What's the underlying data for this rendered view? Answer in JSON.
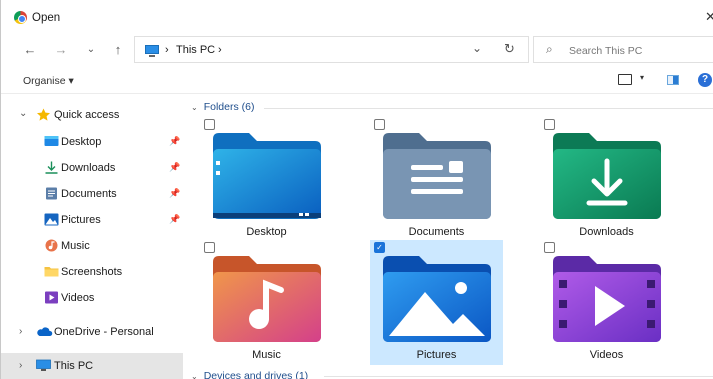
{
  "window": {
    "title": "Open",
    "close_glyph": "✕"
  },
  "nav": {
    "back": "←",
    "forward": "→",
    "recent": "⌄",
    "up": "↑"
  },
  "address": {
    "crumb_sep": "›",
    "location": "This PC",
    "trailing_sep": "›",
    "dropdown": "⌄",
    "refresh": "↻"
  },
  "search": {
    "placeholder": "Search This PC",
    "icon": "⌕"
  },
  "toolbar": {
    "organise": "Organise ▾",
    "view_caret": "▾",
    "help": "?"
  },
  "sidebar": {
    "items": [
      {
        "label": "Quick access",
        "chevron": "⌄",
        "icon": "star-icon"
      },
      {
        "label": "Desktop",
        "icon": "desktop-icon",
        "pinned": true
      },
      {
        "label": "Downloads",
        "icon": "download-icon",
        "pinned": true
      },
      {
        "label": "Documents",
        "icon": "documents-icon",
        "pinned": true
      },
      {
        "label": "Pictures",
        "icon": "pictures-icon",
        "pinned": true
      },
      {
        "label": "Music",
        "icon": "music-icon"
      },
      {
        "label": "Screenshots",
        "icon": "folder-icon"
      },
      {
        "label": "Videos",
        "icon": "videos-icon"
      },
      {
        "label": "OneDrive - Personal",
        "chevron": "›",
        "icon": "cloud-icon"
      },
      {
        "label": "This PC",
        "chevron": "›",
        "icon": "pc-icon",
        "selected": true
      }
    ],
    "pin_glyph": "📌"
  },
  "content": {
    "folders_header": "Folders (6)",
    "devices_header": "Devices and drives (1)",
    "group_chevron": "⌄",
    "folders": [
      {
        "label": "Desktop",
        "checked": false
      },
      {
        "label": "Documents",
        "checked": false
      },
      {
        "label": "Downloads",
        "checked": false
      },
      {
        "label": "Music",
        "checked": false
      },
      {
        "label": "Pictures",
        "checked": true
      },
      {
        "label": "Videos",
        "checked": false
      }
    ],
    "check_glyph": "✓"
  },
  "colors": {
    "accent": "#1a73d9",
    "selection": "#cce8ff",
    "header_text": "#1f4e8c"
  }
}
